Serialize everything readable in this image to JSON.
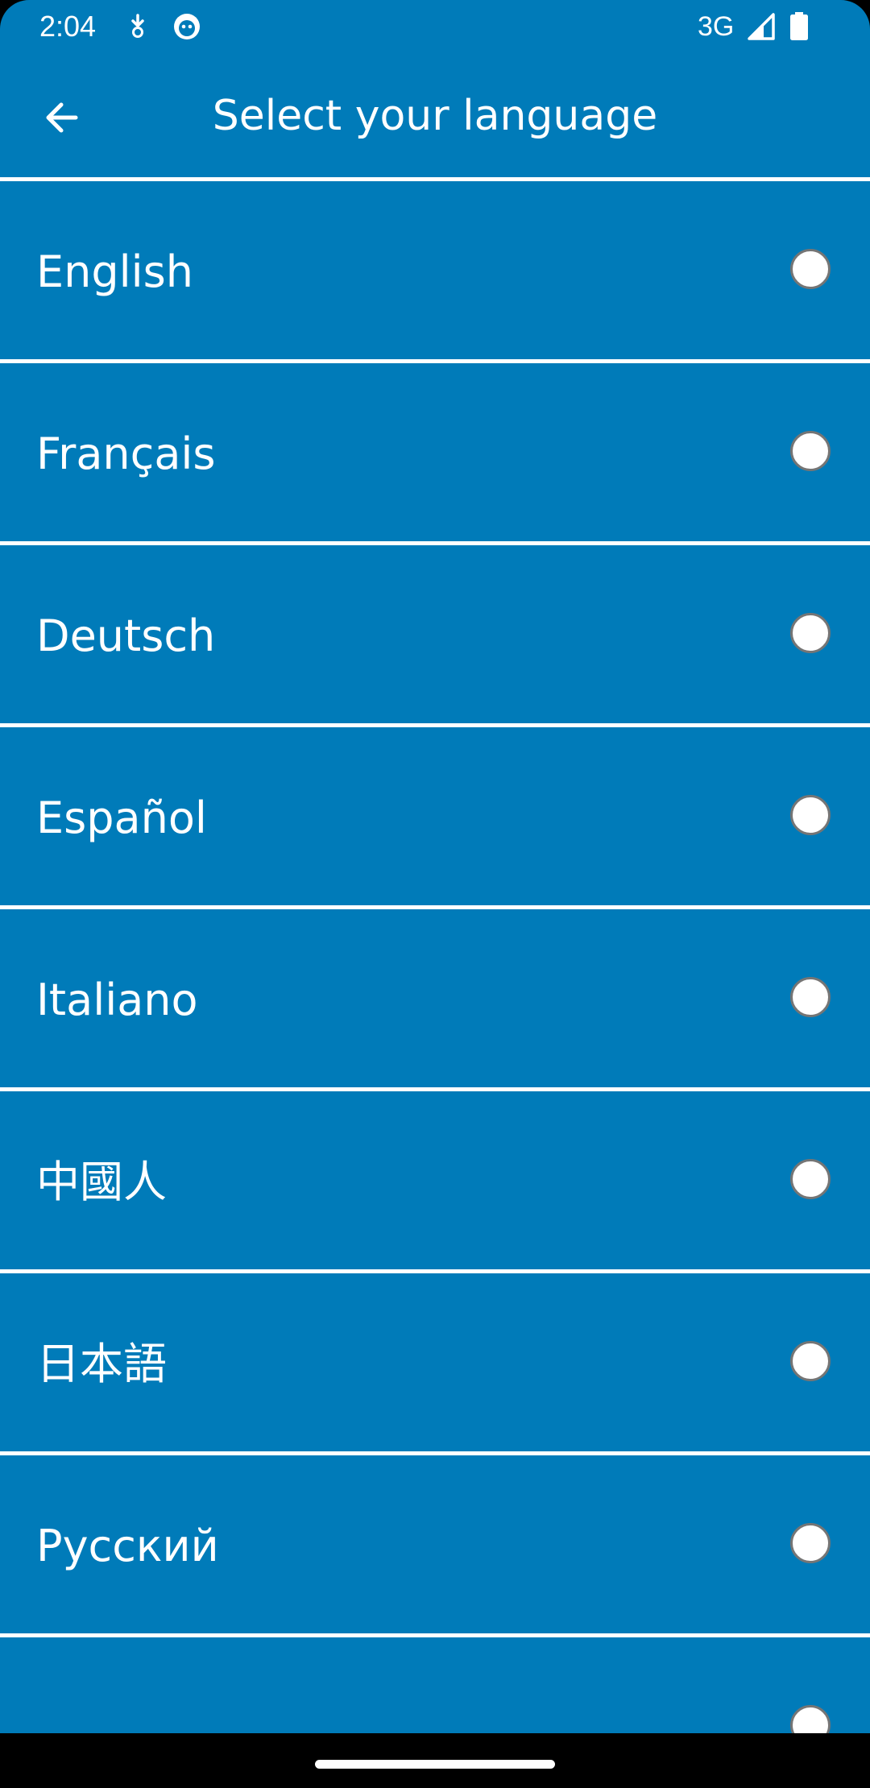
{
  "status_bar": {
    "time": "2:04",
    "network": "3G",
    "icons": [
      "download-notification-icon",
      "face-notification-icon",
      "signal-icon",
      "battery-icon"
    ]
  },
  "app_bar": {
    "title": "Select your language",
    "back_icon": "arrow-left-icon"
  },
  "languages": [
    {
      "label": "English",
      "selected": false
    },
    {
      "label": "Français",
      "selected": false
    },
    {
      "label": "Deutsch",
      "selected": false
    },
    {
      "label": "Español",
      "selected": false
    },
    {
      "label": "Italiano",
      "selected": false
    },
    {
      "label": "中國人",
      "selected": false
    },
    {
      "label": "日本語",
      "selected": false
    },
    {
      "label": "Русский",
      "selected": false
    },
    {
      "label": "",
      "selected": false
    }
  ],
  "colors": {
    "background": "#007bb9",
    "divider": "#ffffff",
    "text": "#ffffff",
    "radio_fill": "#ffffff",
    "radio_border": "#757575"
  }
}
